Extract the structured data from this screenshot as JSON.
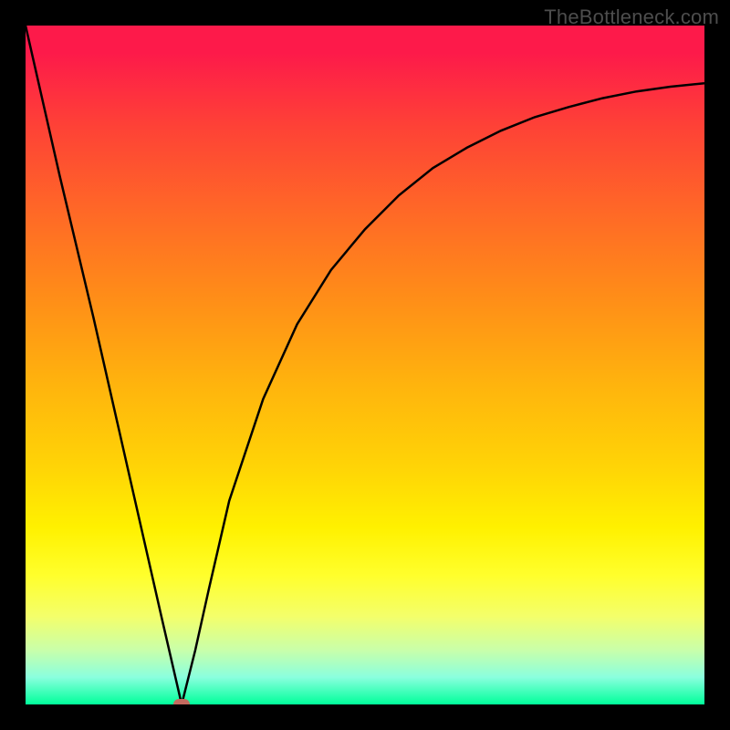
{
  "watermark": "TheBottleneck.com",
  "chart_data": {
    "type": "line",
    "title": "",
    "xlabel": "",
    "ylabel": "",
    "xlim": [
      0,
      100
    ],
    "ylim": [
      0,
      100
    ],
    "background": {
      "gradient_stops": [
        {
          "pos": 0,
          "color": "#fd1a4a"
        },
        {
          "pos": 15,
          "color": "#fe4236"
        },
        {
          "pos": 40,
          "color": "#ff8d18"
        },
        {
          "pos": 65,
          "color": "#ffd406"
        },
        {
          "pos": 81,
          "color": "#ffff2c"
        },
        {
          "pos": 100,
          "color": "#00ff9a"
        }
      ]
    },
    "series": [
      {
        "name": "bottleneck-curve",
        "x": [
          0,
          5,
          10,
          15,
          20,
          23,
          25,
          27,
          30,
          35,
          40,
          45,
          50,
          55,
          60,
          65,
          70,
          75,
          80,
          85,
          90,
          95,
          100
        ],
        "y": [
          100,
          78,
          57,
          35,
          13,
          0,
          8,
          17,
          30,
          45,
          56,
          64,
          70,
          75,
          79,
          82,
          84.5,
          86.5,
          88,
          89.3,
          90.3,
          91,
          91.5
        ]
      }
    ],
    "marker": {
      "x": 23,
      "y": 0,
      "color": "#c46a5f"
    }
  }
}
